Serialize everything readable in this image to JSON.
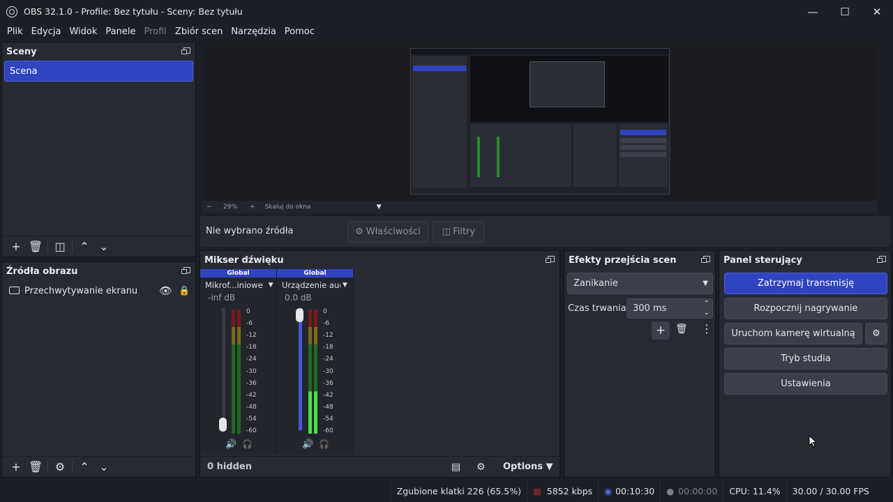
{
  "window": {
    "title": "OBS 32.1.0 - Profile: Bez tytułu - Sceny: Bez tytułu"
  },
  "menu": [
    "Plik",
    "Edycja",
    "Widok",
    "Panele",
    "Profil",
    "Zbiór scen",
    "Narzędzia",
    "Pomoc"
  ],
  "scenes": {
    "title": "Sceny",
    "items": [
      "Scena"
    ]
  },
  "sources": {
    "title": "Źródła obrazu",
    "items": [
      "Przechwytywanie ekranu"
    ]
  },
  "preview": {
    "zoom": "29%",
    "scale_mode": "Skaluj do okna"
  },
  "context": {
    "no_source": "Nie wybrano źródła",
    "properties": "Właściwości",
    "filters": "Filtry"
  },
  "mixer": {
    "title": "Mikser dźwięku",
    "channels": [
      {
        "header": "Global",
        "name": "Mikrof...iniowe",
        "db": "-inf dB",
        "volume": 0.0
      },
      {
        "header": "Global",
        "name": "Urządzenie audio",
        "db": "0.0 dB",
        "volume": 1.0
      }
    ],
    "scale": [
      "0",
      "-6",
      "-12",
      "-18",
      "-24",
      "-30",
      "-36",
      "-42",
      "-48",
      "-54",
      "-60"
    ],
    "hidden": "0 hidden",
    "options": "Options"
  },
  "transitions": {
    "title": "Efekty przejścia scen",
    "selected": "Zanikanie",
    "duration_label": "Czas trwania",
    "duration": "300 ms"
  },
  "controls": {
    "title": "Panel sterujący",
    "stop_stream": "Zatrzymaj transmisję",
    "start_record": "Rozpocznij nagrywanie",
    "virtual_cam": "Uruchom kamerę wirtualną",
    "studio": "Tryb studia",
    "settings": "Ustawienia"
  },
  "status": {
    "dropped": "Zgubione klatki 226 (65.5%)",
    "bitrate": "5852 kbps",
    "stream_time": "00:10:30",
    "rec_time": "00:00:00",
    "cpu": "CPU: 11.4%",
    "fps": "30.00 / 30.00 FPS"
  },
  "colors": {
    "accent": "#2f44c0",
    "panel": "#272a33",
    "background": "#1d1f26"
  }
}
